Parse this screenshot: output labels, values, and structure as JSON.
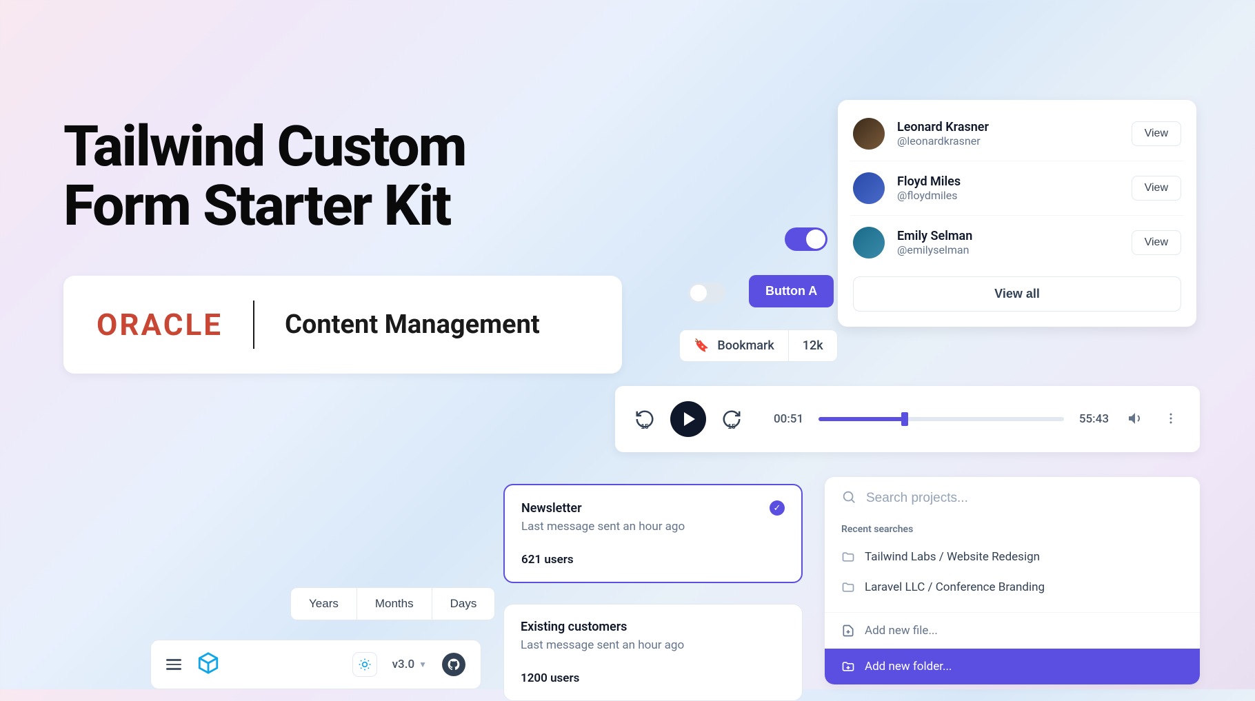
{
  "hero": {
    "title_line1": "Tailwind Custom",
    "title_line2": "Form Starter Kit"
  },
  "oracle": {
    "logo": "ORACLE",
    "subtitle": "Content Management"
  },
  "people": {
    "items": [
      {
        "name": "Leonard Krasner",
        "handle": "@leonardkrasner",
        "view": "View"
      },
      {
        "name": "Floyd Miles",
        "handle": "@floydmiles",
        "view": "View"
      },
      {
        "name": "Emily Selman",
        "handle": "@emilyselman",
        "view": "View"
      }
    ],
    "view_all": "View all"
  },
  "button_a": "Button A",
  "bookmark": {
    "label": "Bookmark",
    "count": "12k"
  },
  "player": {
    "back_seconds": "15",
    "fwd_seconds": "15",
    "current": "00:51",
    "total": "55:43",
    "progress_pct": 35
  },
  "newsletter": {
    "title": "Newsletter",
    "subtitle": "Last message sent an hour ago",
    "users": "621 users"
  },
  "existing": {
    "title": "Existing customers",
    "subtitle": "Last message sent an hour ago",
    "users": "1200 users"
  },
  "search": {
    "placeholder": "Search projects...",
    "recent_heading": "Recent searches",
    "recent": [
      "Tailwind Labs / Website Redesign",
      "Laravel LLC / Conference Branding"
    ],
    "add_file": "Add new file...",
    "add_folder": "Add new folder..."
  },
  "segmented": [
    "Years",
    "Months",
    "Days"
  ],
  "bottombar": {
    "version": "v3.0"
  }
}
